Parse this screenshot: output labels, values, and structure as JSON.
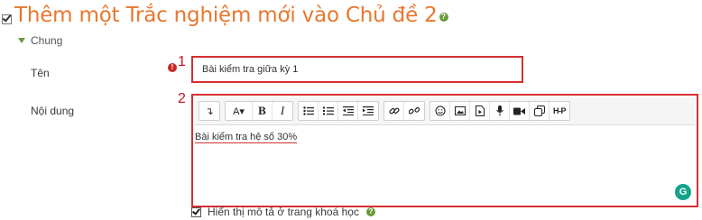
{
  "page": {
    "title": "Thêm một Trắc nghiệm mới vào Chủ đề 2",
    "title_icon": "quiz-checkbox-icon",
    "help_icon": "question-circle-icon"
  },
  "section": {
    "label": "Chung",
    "icon": "caret-down-icon"
  },
  "fields": {
    "name": {
      "label": "Tên",
      "required_icon": "required-exclamation-icon",
      "required_glyph": "!",
      "value": "Bài kiểm tra giữa kỳ 1",
      "annotation": "1"
    },
    "description": {
      "label": "Nội dung",
      "annotation": "2",
      "content": "Bài kiểm tra hệ số 30%",
      "grammarly_icon": "grammarly-icon",
      "grammarly_glyph": "G"
    }
  },
  "toolbar": {
    "buttons": [
      {
        "name": "collapse-toolbar-icon",
        "glyph": "↴"
      },
      {
        "name": "font-style-icon",
        "glyph": "A▾"
      },
      {
        "name": "bold-icon",
        "glyph": "B"
      },
      {
        "name": "italic-icon",
        "glyph": "I"
      },
      {
        "name": "bulleted-list-icon"
      },
      {
        "name": "numbered-list-icon"
      },
      {
        "name": "outdent-icon"
      },
      {
        "name": "indent-icon"
      },
      {
        "name": "link-icon"
      },
      {
        "name": "unlink-icon"
      },
      {
        "name": "emoji-icon"
      },
      {
        "name": "insert-image-icon"
      },
      {
        "name": "insert-media-icon"
      },
      {
        "name": "record-audio-icon"
      },
      {
        "name": "record-video-icon"
      },
      {
        "name": "manage-files-icon"
      },
      {
        "name": "h5p-icon",
        "glyph": "H-P"
      }
    ]
  },
  "display_description": {
    "label": "Hiển thị mô tả ở trang khoá học",
    "checked": true,
    "help_icon": "question-circle-icon"
  },
  "colors": {
    "title": "#e8772e",
    "annotation_border": "#d63031",
    "help_green": "#6a9a3b"
  }
}
